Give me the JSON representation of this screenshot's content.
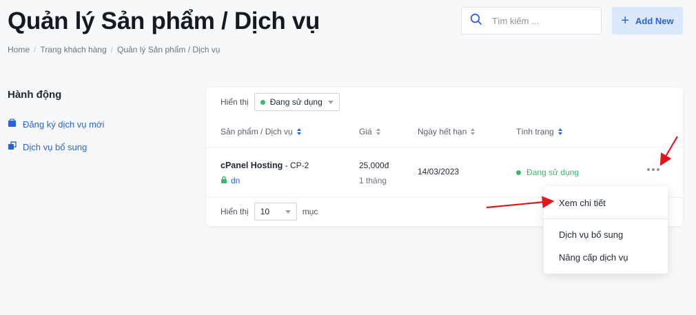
{
  "page": {
    "title": "Quản lý Sản phẩm / Dịch vụ",
    "breadcrumb": [
      "Home",
      "Trang khách hàng",
      "Quản lý Sản phẩm / Dịch vụ"
    ],
    "breadcrumb_sep": "/"
  },
  "search": {
    "placeholder": "Tìm kiếm ..."
  },
  "add_button": {
    "label": "Add New"
  },
  "sidebar": {
    "title": "Hành động",
    "links": [
      {
        "label": "Đăng ký dịch vụ mới",
        "icon": "cart-icon"
      },
      {
        "label": "Dịch vụ bổ sung",
        "icon": "addon-icon"
      }
    ]
  },
  "table": {
    "filter_label": "Hiển thị",
    "filter_value": "Đang sử dụng",
    "columns": [
      "Sản phẩm / Dịch vụ",
      "Giá",
      "Ngày hết hạn",
      "Tình trạng"
    ],
    "rows": [
      {
        "product": "cPanel Hosting",
        "product_suffix": " - CP-2",
        "domain": "dn",
        "price": "25,000đ",
        "period": "1 tháng",
        "expiry": "14/03/2023",
        "status": "Đang sử dụng"
      }
    ],
    "footer": {
      "show_label": "Hiển thị",
      "per_page": "10",
      "unit": "mục"
    }
  },
  "dropdown": {
    "items": [
      "Xem chi tiết",
      "Dịch vụ bổ sung",
      "Nâng cấp dịch vụ"
    ]
  },
  "colors": {
    "accent": "#2a63d6",
    "status_green": "#3cb66a",
    "annotation_red": "#e3151d"
  }
}
